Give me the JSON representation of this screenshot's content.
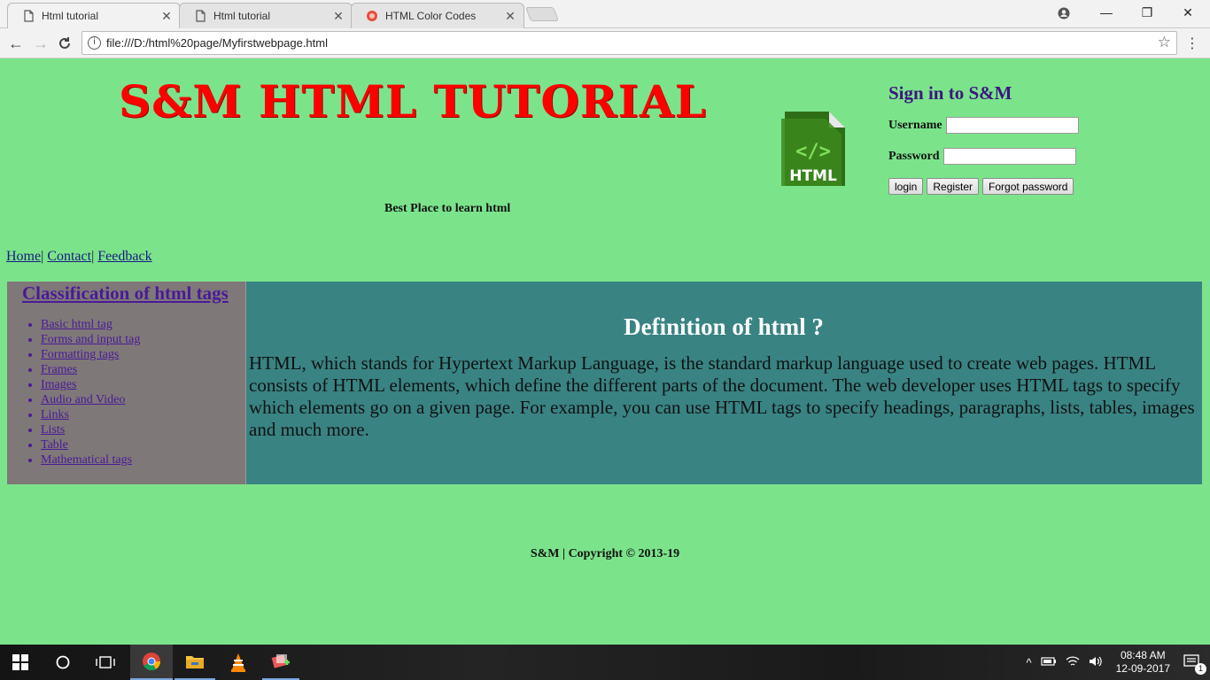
{
  "browser": {
    "tabs": [
      {
        "title": "Html tutorial",
        "active": true
      },
      {
        "title": "Html tutorial",
        "active": false
      },
      {
        "title": "HTML Color Codes",
        "active": false
      }
    ],
    "tab_close": "✕",
    "address": "file:///D:/html%20page/Myfirstwebpage.html",
    "window_controls": {
      "minimize": "—",
      "maximize": "❐",
      "close": "✕"
    }
  },
  "page": {
    "site_title": "S&M HTML TUTORIAL",
    "tagline": "Best Place to learn html",
    "logo_text": "HTML",
    "logo_glyph": "</>",
    "signin": {
      "heading": "Sign in to S&M",
      "username_label": "Username",
      "password_label": "Password",
      "username_value": "",
      "password_value": "",
      "login_button": "login",
      "register_button": "Register",
      "forgot_button": "Forgot password"
    },
    "nav": {
      "home": "Home",
      "contact": "Contact",
      "feedback": "Feedback",
      "separator": "|"
    },
    "sidebar": {
      "heading": "Classification of html tags",
      "items": [
        {
          "label": "Basic html tag"
        },
        {
          "label": "Forms and input tag"
        },
        {
          "label": "Formatting tags"
        },
        {
          "label": "Frames"
        },
        {
          "label": "Images"
        },
        {
          "label": "Audio and Video"
        },
        {
          "label": "Links"
        },
        {
          "label": "Lists"
        },
        {
          "label": "Table"
        },
        {
          "label": "Mathematical tags"
        }
      ]
    },
    "main": {
      "heading": "Definition of html ?",
      "paragraph": "HTML, which stands for Hypertext Markup Language, is the standard markup language used to create web pages. HTML consists of HTML elements, which define the different parts of the document. The web developer uses HTML tags to specify which elements go on a given page. For example, you can use HTML tags to specify headings, paragraphs, lists, tables, images and much more."
    },
    "footer": "S&M | Copyright © 2013-19"
  },
  "taskbar": {
    "clock_time": "08:48 AM",
    "clock_date": "12-09-2017",
    "notification_count": "1"
  },
  "colors": {
    "page_bg": "#7be48b",
    "title_red": "#ff0000",
    "sidebar_bg": "#7f7878",
    "main_bg": "#398383",
    "link_purple": "#4a1a96"
  }
}
